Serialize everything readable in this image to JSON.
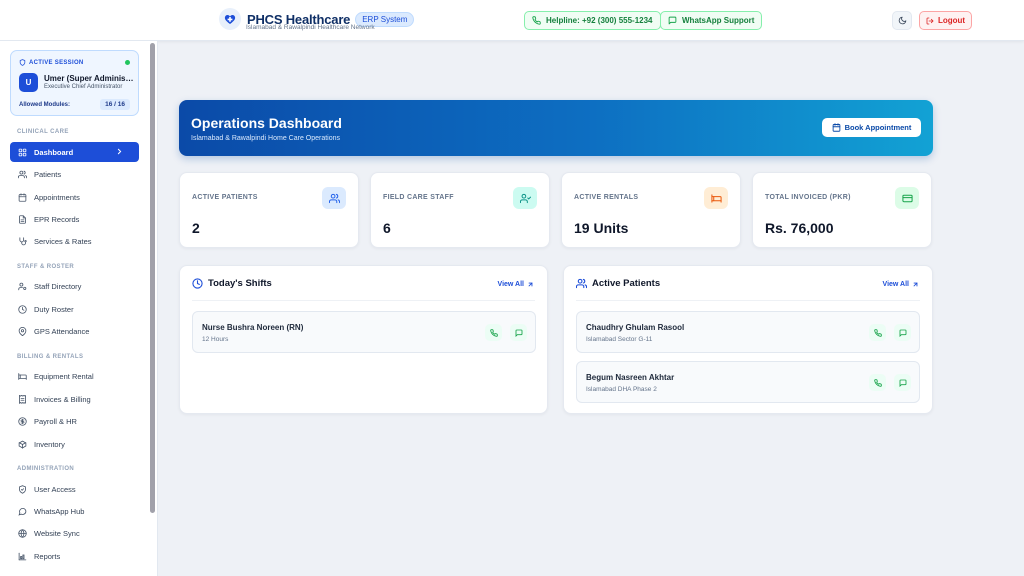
{
  "header": {
    "brand_title": "PHCS Healthcare",
    "brand_badge": "ERP System",
    "brand_subtitle": "Islamabad & Rawalpindi Healthcare Network",
    "helpline_label": "Helpline: +92 (300) 555-1234",
    "whatsapp_label": "WhatsApp Support",
    "logout_label": "Logout",
    "icons": {
      "logo": "medical-logo-icon",
      "phone": "phone-icon",
      "whatsapp": "chat-icon",
      "theme": "moon-icon",
      "logout": "logout-icon"
    }
  },
  "session": {
    "tag": "ACTIVE SESSION",
    "avatar_initial": "U",
    "name": "Umer (Super Administrator)",
    "role": "Executive Chief Administrator",
    "modules_label": "Allowed Modules:",
    "modules_value": "16 / 16",
    "status_color": "#22c55e"
  },
  "sidebar": {
    "sections": [
      {
        "label": "CLINICAL CARE",
        "items": [
          {
            "label": "Dashboard",
            "icon": "grid-icon",
            "active": true
          },
          {
            "label": "Patients",
            "icon": "users-icon"
          },
          {
            "label": "Appointments",
            "icon": "calendar-icon"
          },
          {
            "label": "EPR Records",
            "icon": "file-icon"
          },
          {
            "label": "Services & Rates",
            "icon": "stethoscope-icon"
          }
        ]
      },
      {
        "label": "STAFF & ROSTER",
        "items": [
          {
            "label": "Staff Directory",
            "icon": "user-cog-icon"
          },
          {
            "label": "Duty Roster",
            "icon": "clock-icon"
          },
          {
            "label": "GPS Attendance",
            "icon": "map-pin-icon"
          }
        ]
      },
      {
        "label": "BILLING & RENTALS",
        "items": [
          {
            "label": "Equipment Rental",
            "icon": "bed-icon"
          },
          {
            "label": "Invoices & Billing",
            "icon": "receipt-icon"
          },
          {
            "label": "Payroll & HR",
            "icon": "dollar-icon"
          },
          {
            "label": "Inventory",
            "icon": "box-icon"
          }
        ]
      },
      {
        "label": "ADMINISTRATION",
        "items": [
          {
            "label": "User Access",
            "icon": "shield-icon"
          },
          {
            "label": "WhatsApp Hub",
            "icon": "chat-icon"
          },
          {
            "label": "Website Sync",
            "icon": "globe-icon"
          },
          {
            "label": "Reports",
            "icon": "bar-chart-icon"
          }
        ]
      }
    ]
  },
  "hero": {
    "title": "Operations Dashboard",
    "subtitle": "Islamabad & Rawalpindi Home Care Operations",
    "button_label": "Book Appointment"
  },
  "stats": [
    {
      "label": "ACTIVE PATIENTS",
      "value": "2",
      "icon": "users-icon",
      "color": "#2563eb"
    },
    {
      "label": "FIELD CARE STAFF",
      "value": "6",
      "icon": "user-check-icon",
      "color": "#0d9488"
    },
    {
      "label": "ACTIVE RENTALS",
      "value": "19 Units",
      "icon": "bed-icon",
      "color": "#ea580c"
    },
    {
      "label": "TOTAL INVOICED (PKR)",
      "value": "Rs. 76,000",
      "icon": "credit-card-icon",
      "color": "#16a34a"
    }
  ],
  "shifts": {
    "title": "Today's Shifts",
    "link": "View All",
    "items": [
      {
        "name": "Nurse Bushra Noreen (RN)",
        "detail": "12 Hours"
      }
    ]
  },
  "patients": {
    "title": "Active Patients",
    "link": "View All",
    "items": [
      {
        "name": "Chaudhry Ghulam Rasool",
        "detail": "Islamabad Sector G-11"
      },
      {
        "name": "Begum Nasreen Akhtar",
        "detail": "Islamabad DHA Phase 2"
      }
    ]
  }
}
